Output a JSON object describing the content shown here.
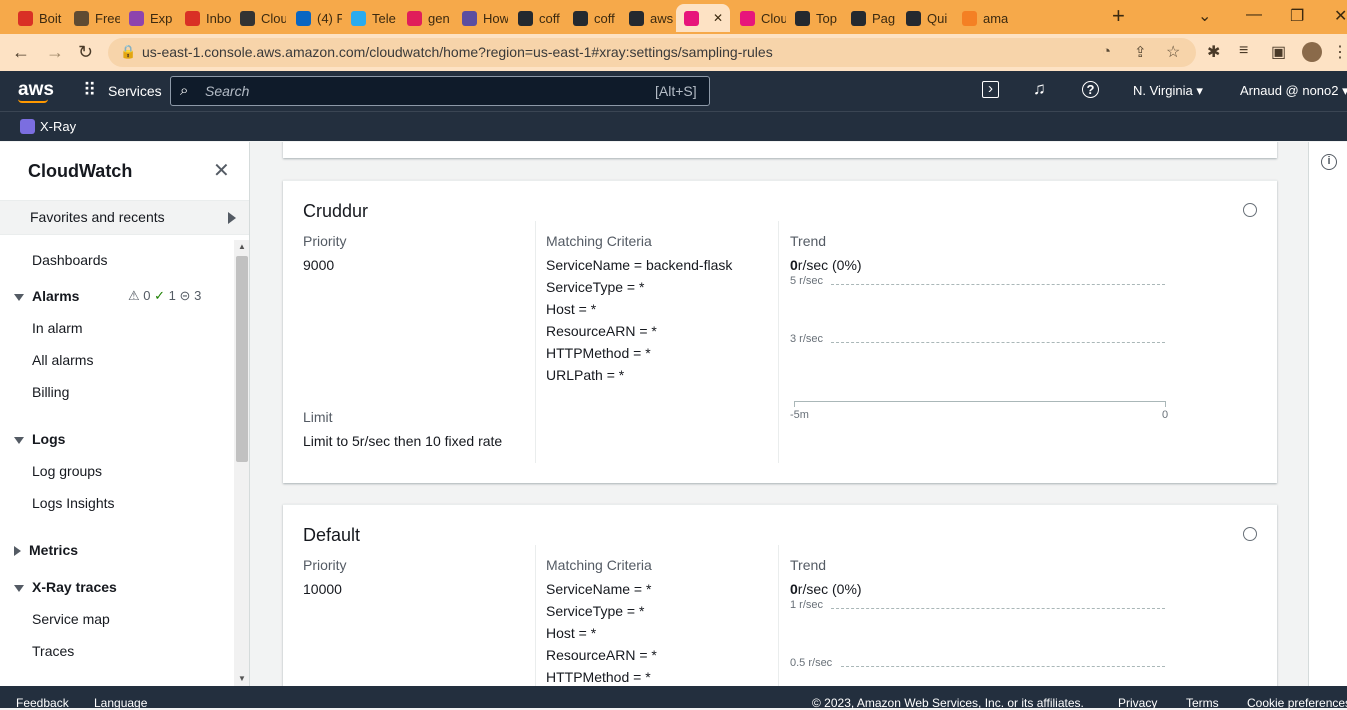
{
  "browser": {
    "tabs": [
      {
        "label": "Boit",
        "icon": "gmail-icon",
        "color": "#d93025"
      },
      {
        "label": "Free",
        "icon": "glasses-icon",
        "color": "#5f4b32"
      },
      {
        "label": "Exp",
        "icon": "slack-icon",
        "color": "#8e44ad"
      },
      {
        "label": "Inbo",
        "icon": "gmail-icon",
        "color": "#d93025"
      },
      {
        "label": "Clou",
        "icon": "globe-icon",
        "color": "#333333"
      },
      {
        "label": "(4) F",
        "icon": "linkedin-icon",
        "color": "#0a66c2"
      },
      {
        "label": "Tele",
        "icon": "telegram-icon",
        "color": "#2aabee"
      },
      {
        "label": "gen",
        "icon": "slack-icon",
        "color": "#e01e5a"
      },
      {
        "label": "How",
        "icon": "cloud-icon",
        "color": "#5b4ea0"
      },
      {
        "label": "coff",
        "icon": "github-icon",
        "color": "#24292f"
      },
      {
        "label": "coff",
        "icon": "github-icon",
        "color": "#24292f"
      },
      {
        "label": "aws",
        "icon": "github-icon",
        "color": "#24292f"
      },
      {
        "label": "",
        "icon": "cloudwatch-icon",
        "color": "#e7157b",
        "active": true
      },
      {
        "label": "Clou",
        "icon": "cloudwatch-icon",
        "color": "#e7157b"
      },
      {
        "label": "Top",
        "icon": "github-icon",
        "color": "#24292f"
      },
      {
        "label": "Pag",
        "icon": "github-icon",
        "color": "#24292f"
      },
      {
        "label": "Qui",
        "icon": "github-icon",
        "color": "#24292f"
      },
      {
        "label": "ama",
        "icon": "stackoverflow-icon",
        "color": "#f48024"
      }
    ],
    "new_tab": "+",
    "url": "us-east-1.console.aws.amazon.com/cloudwatch/home?region=us-east-1#xray:settings/sampling-rules"
  },
  "aws": {
    "logo": "aws",
    "services": "Services",
    "search_placeholder": "Search",
    "search_shortcut": "[Alt+S]",
    "region": "N. Virginia",
    "account": "Arnaud @ nono2",
    "breadcrumb_service": "X-Ray"
  },
  "sidebar": {
    "title": "CloudWatch",
    "favorites": "Favorites and recents",
    "dashboards": "Dashboards",
    "alarms": {
      "label": "Alarms",
      "alarm_count": "0",
      "ok_count": "1",
      "insufficient_count": "3"
    },
    "alarm_items": [
      "In alarm",
      "All alarms",
      "Billing"
    ],
    "logs": "Logs",
    "log_items": [
      "Log groups",
      "Logs Insights"
    ],
    "metrics": "Metrics",
    "xray": "X-Ray traces",
    "xray_items": [
      "Service map",
      "Traces"
    ]
  },
  "rules": [
    {
      "name": "Cruddur",
      "priority_label": "Priority",
      "priority": "9000",
      "limit_label": "Limit",
      "limit": "Limit to 5r/sec then 10 fixed rate",
      "criteria_label": "Matching Criteria",
      "criteria": [
        "ServiceName = backend-flask",
        "ServiceType = *",
        "Host = *",
        "ResourceARN = *",
        "HTTPMethod = *",
        "URLPath = *"
      ],
      "trend_label": "Trend",
      "trend_value": "0",
      "trend_suffix": "r/sec (0%)",
      "y_ticks": [
        "5 r/sec",
        "3 r/sec"
      ],
      "x_ticks": [
        "-5m",
        "0"
      ]
    },
    {
      "name": "Default",
      "priority_label": "Priority",
      "priority": "10000",
      "criteria_label": "Matching Criteria",
      "criteria": [
        "ServiceName = *",
        "ServiceType = *",
        "Host = *",
        "ResourceARN = *",
        "HTTPMethod = *"
      ],
      "trend_label": "Trend",
      "trend_value": "0",
      "trend_suffix": "r/sec (0%)",
      "y_ticks": [
        "1 r/sec",
        "0.5 r/sec"
      ]
    }
  ],
  "footer": {
    "feedback": "Feedback",
    "language": "Language",
    "copyright": "© 2023, Amazon Web Services, Inc. or its affiliates.",
    "privacy": "Privacy",
    "terms": "Terms",
    "cookies": "Cookie preferences"
  }
}
